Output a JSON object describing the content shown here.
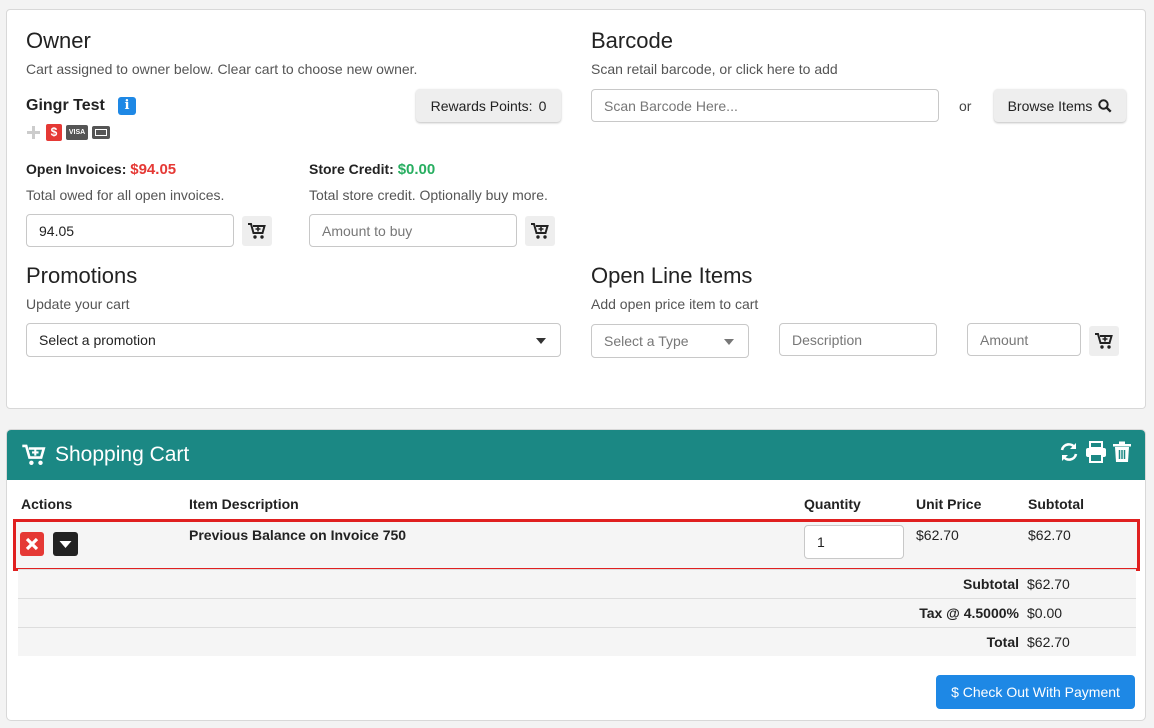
{
  "owner": {
    "title": "Owner",
    "subtitle": "Cart assigned to owner below. Clear cart to choose new owner.",
    "name": "Gingr Test",
    "info_icon": "info-icon",
    "rewards_label": "Rewards Points:",
    "rewards_value": "0",
    "badges": [
      "plus-icon",
      "dollar-icon",
      "visa-card-icon",
      "card-icon"
    ],
    "visa_text": "VISA"
  },
  "open_invoices": {
    "label": "Open Invoices:",
    "amount": "$94.05",
    "desc": "Total owed for all open invoices.",
    "input_value": "94.05"
  },
  "store_credit": {
    "label": "Store Credit:",
    "amount": "$0.00",
    "desc": "Total store credit. Optionally buy more.",
    "input_placeholder": "Amount to buy"
  },
  "barcode": {
    "title": "Barcode",
    "subtitle": "Scan retail barcode, or click here to add",
    "placeholder": "Scan Barcode Here...",
    "or_text": "or",
    "browse_label": "Browse Items"
  },
  "promotions": {
    "title": "Promotions",
    "subtitle": "Update your cart",
    "select_value": "Select a promotion"
  },
  "open_line_items": {
    "title": "Open Line Items",
    "subtitle": "Add open price item to cart",
    "type_placeholder": "Select a Type",
    "description_placeholder": "Description",
    "amount_placeholder": "Amount"
  },
  "cart": {
    "title": "Shopping Cart",
    "columns": [
      "Actions",
      "Item Description",
      "Quantity",
      "Unit Price",
      "Subtotal"
    ],
    "items": [
      {
        "description": "Previous Balance on Invoice 750",
        "quantity": "1",
        "unit_price": "$62.70",
        "subtotal": "$62.70"
      }
    ],
    "summary": {
      "subtotal_label": "Subtotal",
      "subtotal_value": "$62.70",
      "tax_label": "Tax @ 4.5000%",
      "tax_value": "$0.00",
      "total_label": "Total",
      "total_value": "$62.70"
    },
    "checkout_label": "$ Check Out With Payment"
  },
  "colors": {
    "teal_header": "#1b8884",
    "danger": "#e53935",
    "success": "#27ae60",
    "primary": "#1e88e5"
  }
}
